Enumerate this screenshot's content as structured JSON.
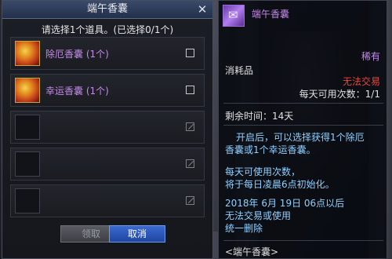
{
  "dialog": {
    "title": "端午香囊",
    "close_icon": "✕",
    "instruction": "请选择1个道具。(已选择0/1个)",
    "items": [
      {
        "label": "除厄香囊 (1个)",
        "icon": "sachet-icon",
        "state": "unchecked"
      },
      {
        "label": "幸运香囊 (1个)",
        "icon": "sachet-icon",
        "state": "unchecked"
      },
      {
        "label": "",
        "icon": "",
        "state": "disabled"
      },
      {
        "label": "",
        "icon": "",
        "state": "disabled"
      },
      {
        "label": "",
        "icon": "",
        "state": "disabled"
      }
    ],
    "confirm_label": "领取",
    "cancel_label": "取消"
  },
  "tooltip": {
    "title": "端午香囊",
    "rarity": "稀有",
    "category": "消耗品",
    "tradable": "无法交易",
    "daily_limit": "每天可用次数：1/1",
    "remaining": "剩余时间：14天",
    "desc_line1": "开启后，可以选择获得1个除厄",
    "desc_line2": "香囊或1个幸运香囊。",
    "reset_line1": "每天可使用次数，",
    "reset_line2": "将于每日凌晨6点初始化。",
    "expire_line1": "2018年 6月 19日 06点以后",
    "expire_line2": "无法交易或使用",
    "expire_line3": "统一删除",
    "footer": "<端午香囊>"
  },
  "colors": {
    "rare_purple": "#c48ae8",
    "untradable_red": "#e8463a",
    "desc_blue": "#8fd0ff",
    "cancel_blue": "#2f5fc8"
  }
}
